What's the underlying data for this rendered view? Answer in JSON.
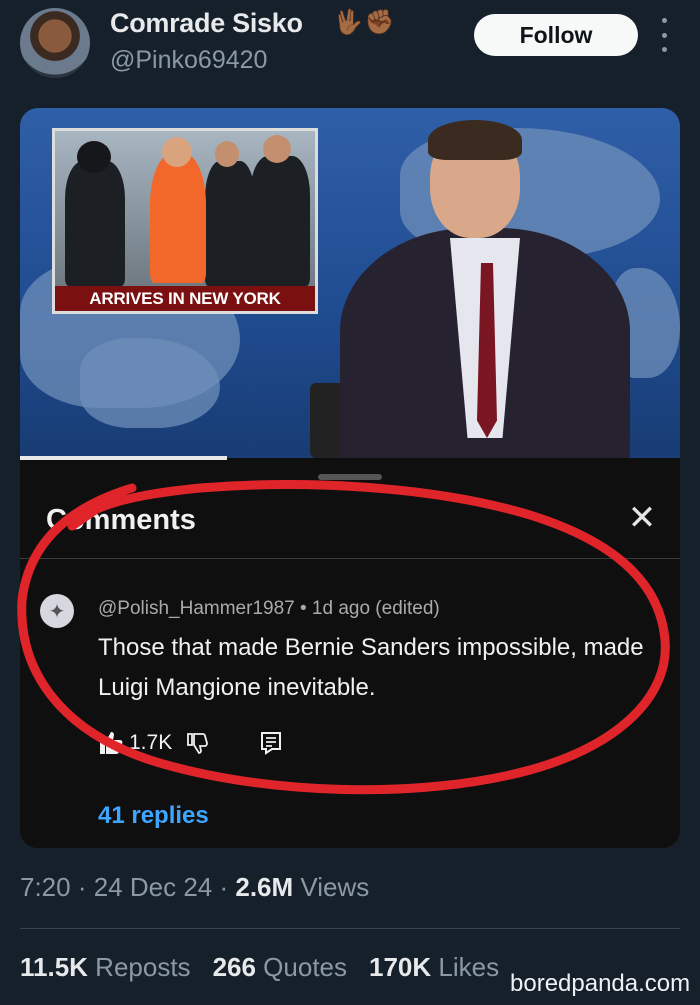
{
  "author": {
    "name": "Comrade Sisko",
    "emoji": "🖖🏾✊🏾",
    "handle": "@Pinko69420",
    "follow_label": "Follow"
  },
  "media": {
    "inset_caption": "ARRIVES IN NEW YORK",
    "comments_panel": {
      "title": "Comments",
      "comment": {
        "meta": "@Polish_Hammer1987 • 1d ago (edited)",
        "text": "Those that made Bernie Sanders impossible, made Luigi Mangione inevitable.",
        "likes": "1.7K"
      },
      "replies_label": "41 replies"
    }
  },
  "meta": {
    "time": "7:20",
    "dot1": " · ",
    "date": "24 Dec 24",
    "dot2": " · ",
    "views_count": "2.6M",
    "views_label": " Views"
  },
  "stats": {
    "reposts_count": "11.5K",
    "reposts_label": " Reposts",
    "quotes_count": "266",
    "quotes_label": " Quotes",
    "likes_count": "170K",
    "likes_label": " Likes"
  },
  "watermark": "boredpanda.com",
  "colors": {
    "background": "#15202b",
    "accent_link": "#3ea6ff",
    "annotation": "#e0252a"
  }
}
